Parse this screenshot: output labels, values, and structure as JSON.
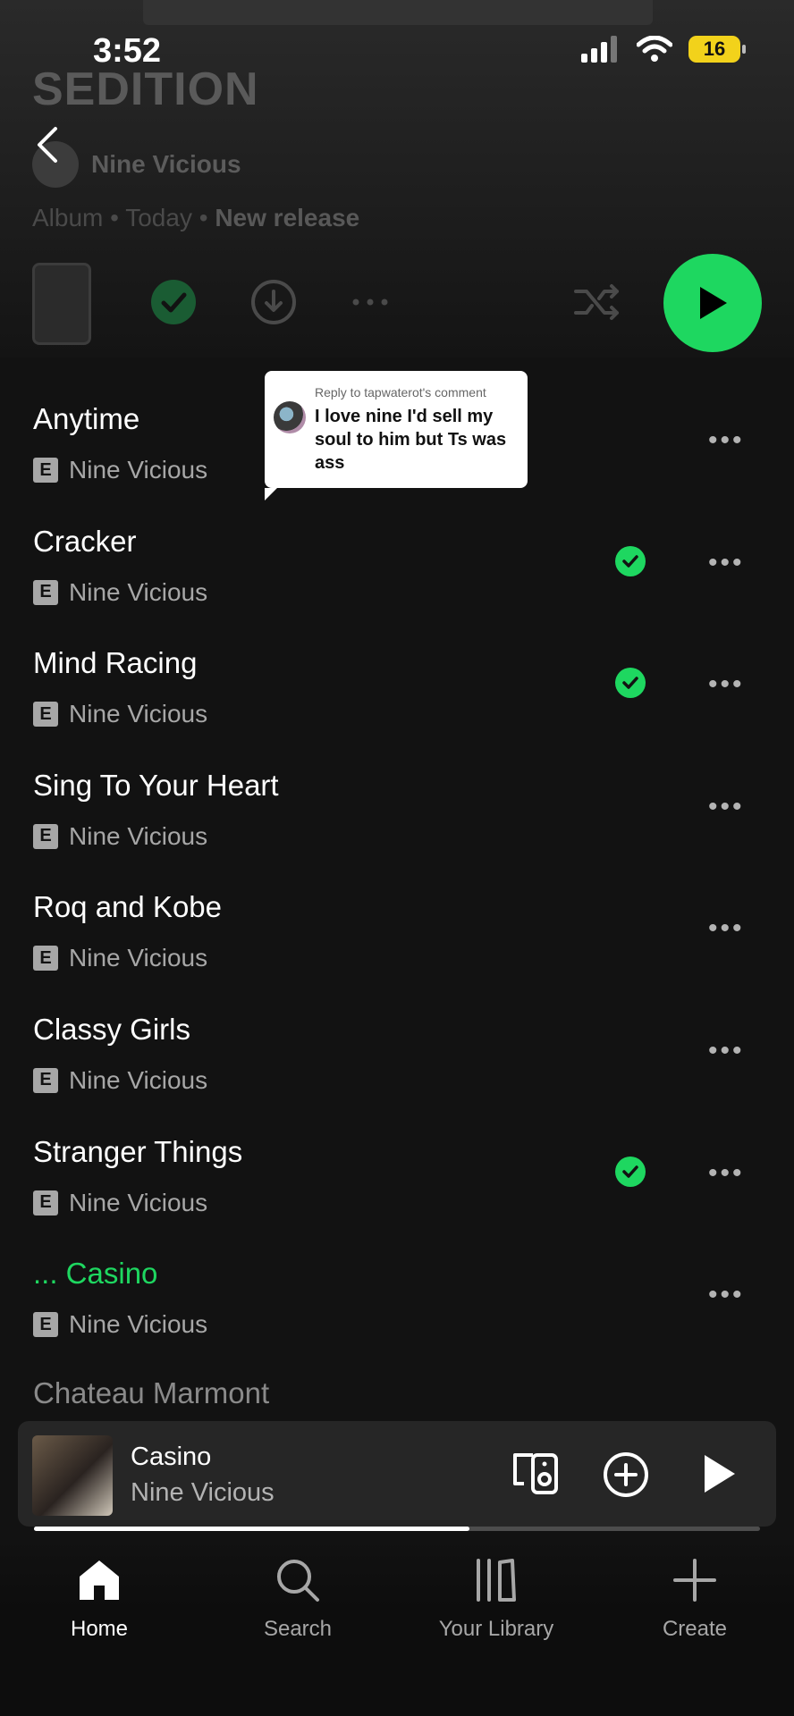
{
  "status_bar": {
    "time": "3:52",
    "battery": "16"
  },
  "album": {
    "title": "SEDITION",
    "artist": "Nine Vicious",
    "meta_type": "Album",
    "meta_date": "Today",
    "meta_tag": "New release"
  },
  "comment": {
    "reply_to": "Reply to tapwaterot's comment",
    "text": "I love nine I'd sell my soul to him but Ts was ass"
  },
  "tracks": [
    {
      "title": "Anytime",
      "artist": "Nine Vicious",
      "explicit": "E",
      "downloaded": false,
      "playing": false
    },
    {
      "title": "Cracker",
      "artist": "Nine Vicious",
      "explicit": "E",
      "downloaded": true,
      "playing": false
    },
    {
      "title": "Mind Racing",
      "artist": "Nine Vicious",
      "explicit": "E",
      "downloaded": true,
      "playing": false
    },
    {
      "title": "Sing To Your Heart",
      "artist": "Nine Vicious",
      "explicit": "E",
      "downloaded": false,
      "playing": false
    },
    {
      "title": "Roq and Kobe",
      "artist": "Nine Vicious",
      "explicit": "E",
      "downloaded": false,
      "playing": false
    },
    {
      "title": "Classy Girls",
      "artist": "Nine Vicious",
      "explicit": "E",
      "downloaded": false,
      "playing": false
    },
    {
      "title": "Stranger Things",
      "artist": "Nine Vicious",
      "explicit": "E",
      "downloaded": true,
      "playing": false
    },
    {
      "title": "... Casino",
      "artist": "Nine Vicious",
      "explicit": "E",
      "downloaded": false,
      "playing": true
    }
  ],
  "partial_track": "Chateau Marmont",
  "now_playing": {
    "title": "Casino",
    "artist": "Nine Vicious",
    "progress": 0.6
  },
  "nav": {
    "home": "Home",
    "search": "Search",
    "library": "Your Library",
    "create": "Create"
  },
  "colors": {
    "accent": "#1ed760",
    "background": "#121212"
  }
}
